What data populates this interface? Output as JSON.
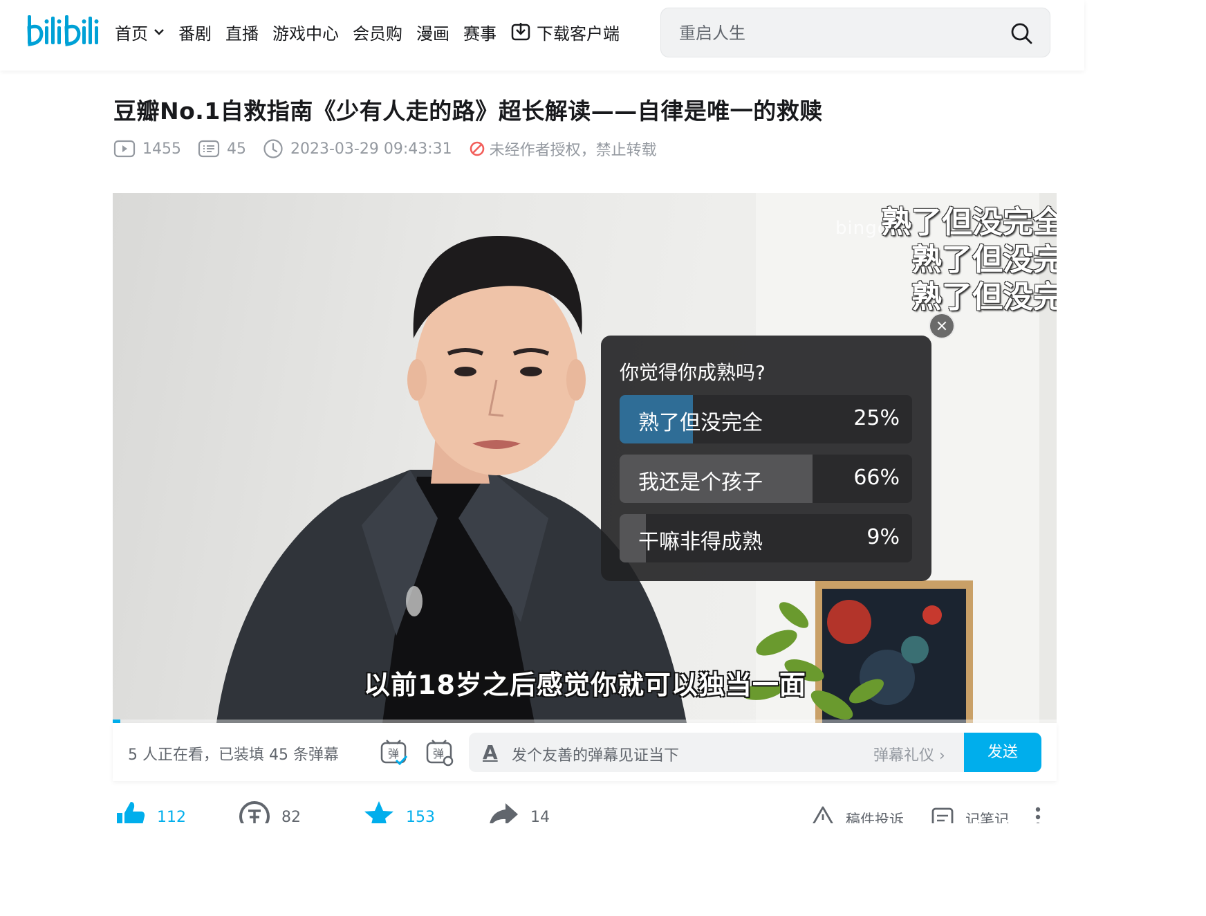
{
  "header": {
    "logo_text": "bilibili",
    "nav": [
      {
        "label": "首页",
        "has_chevron": true
      },
      {
        "label": "番剧"
      },
      {
        "label": "直播"
      },
      {
        "label": "游戏中心"
      },
      {
        "label": "会员购"
      },
      {
        "label": "漫画"
      },
      {
        "label": "赛事"
      },
      {
        "label": "下载客户端",
        "icon": "download-icon"
      }
    ],
    "search": {
      "placeholder": "重启人生",
      "icon": "search-icon"
    }
  },
  "video": {
    "title": "豆瓣No.1自救指南《少有人走的路》超长解读——自律是唯一的救赎",
    "views": "1455",
    "danmaku_count": "45",
    "datetime": "2023-03-29 09:43:31",
    "copyright_notice": "未经作者授权，禁止转载",
    "watermark": "bingo",
    "danmaku": [
      "熟了但没完全",
      "熟了但没完",
      "熟了但没完"
    ],
    "subtitle": "以前18岁之后感觉你就可以独当一面",
    "played_fraction": 0.008
  },
  "poll": {
    "question": "你觉得你成熟吗?",
    "options": [
      {
        "label": "熟了但没完全",
        "percent": "25%",
        "value": 25,
        "chosen": true
      },
      {
        "label": "我还是个孩子",
        "percent": "66%",
        "value": 66,
        "chosen": false
      },
      {
        "label": "干嘛非得成熟",
        "percent": "9%",
        "value": 9,
        "chosen": false
      }
    ]
  },
  "sendbar": {
    "watching_text": "5 人正在看，已装填 45 条弹幕",
    "format_glyph": "A",
    "placeholder": "发个友善的弹幕见证当下",
    "etiquette": "弹幕礼仪 ›",
    "send_label": "发送"
  },
  "toolbar": {
    "like": "112",
    "coin": "82",
    "favorite": "153",
    "share": "14",
    "report": "稿件投诉",
    "notes": "记笔记"
  },
  "colors": {
    "brand_blue": "#00aeec",
    "poll_chosen": "#2f6d96",
    "warn_red": "#f25d59"
  }
}
